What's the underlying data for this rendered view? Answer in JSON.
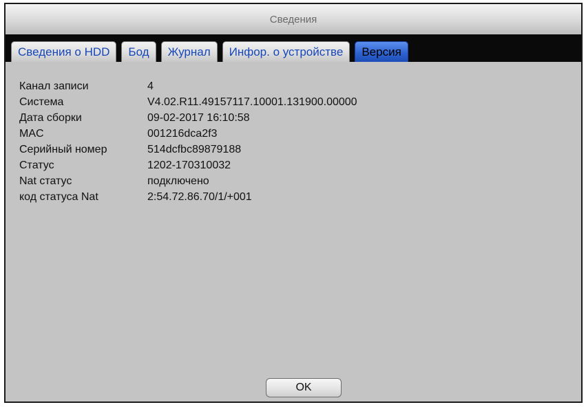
{
  "window": {
    "title": "Сведения"
  },
  "tabs": [
    {
      "label": "Сведения о HDD",
      "active": false
    },
    {
      "label": "Бод",
      "active": false
    },
    {
      "label": "Журнал",
      "active": false
    },
    {
      "label": "Инфор. о устройстве",
      "active": false
    },
    {
      "label": "Версия",
      "active": true
    }
  ],
  "info": [
    {
      "label": "Канал записи",
      "value": "4"
    },
    {
      "label": "Система",
      "value": "V4.02.R11.49157117.10001.131900.00000"
    },
    {
      "label": "Дата сборки",
      "value": "09-02-2017 16:10:58"
    },
    {
      "label": "MAC",
      "value": "001216dca2f3"
    },
    {
      "label": "Серийный номер",
      "value": "514dcfbc89879188"
    },
    {
      "label": "Статус",
      "value": "1202-170310032"
    },
    {
      "label": "Nat статус",
      "value": "подключено"
    },
    {
      "label": "код статуса Nat",
      "value": "2:54.72.86.70/1/+001"
    }
  ],
  "buttons": {
    "ok_label": "OK"
  },
  "colors": {
    "active_tab": "#2f63d0",
    "tab_text": "#1747b8",
    "panel_background": "#c4c4c4"
  }
}
